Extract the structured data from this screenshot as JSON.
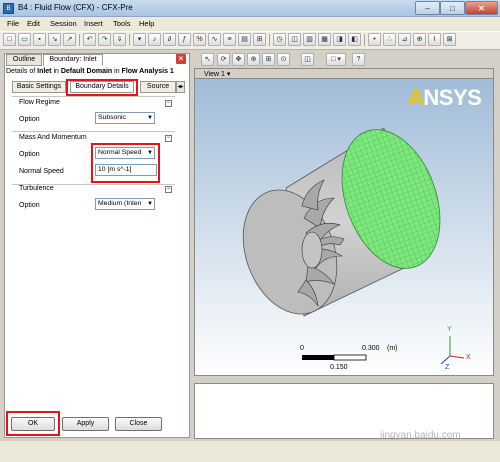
{
  "window": {
    "title": "B4 : Fluid Flow (CFX) - CFX-Pre",
    "app_icon": "cfx-app-icon"
  },
  "menu": [
    "File",
    "Edit",
    "Session",
    "Insert",
    "Tools",
    "Help"
  ],
  "toolbar": {
    "icons": [
      "new-icon",
      "open-icon",
      "save-icon",
      "import-icon",
      "export-icon",
      "undo-icon",
      "redo-icon",
      "insert-icon",
      "material-icon",
      "reaction-icon",
      "expression-icon",
      "function-icon",
      "variable-icon",
      "solver-control-icon",
      "output-control-icon",
      "monitor-icon",
      "mesh-adaption-icon",
      "initialization-icon",
      "interface-icon",
      "domain-icon",
      "boundary-icon",
      "subdomain-icon",
      "source-point-icon",
      "clock-icon",
      "particle-icon",
      "write-solver-icon",
      "calculator-icon",
      "chart-icon",
      "report-icon"
    ]
  },
  "left_panel": {
    "tabs": [
      "Outline",
      "Boundary: Inlet"
    ],
    "details": {
      "p1": "Details of ",
      "inlet": "Inlet",
      "p2": " in ",
      "domain": "Default Domain",
      "p3": " in ",
      "analysis": "Flow Analysis 1"
    },
    "subtabs": [
      "Basic Settings",
      "Boundary Details",
      "Source"
    ],
    "flow_regime": {
      "header": "Flow Regime",
      "option_label": "Option",
      "option_value": "Subsonic"
    },
    "mass_momentum": {
      "header": "Mass And Momentum",
      "option_label": "Option",
      "option_value": "Normal Speed",
      "speed_label": "Normal Speed",
      "speed_value": "10 [m s^-1]"
    },
    "turbulence": {
      "header": "Turbulence",
      "option_label": "Option",
      "option_value": "Medium (Inten"
    },
    "buttons": {
      "ok": "OK",
      "apply": "Apply",
      "close": "Close"
    }
  },
  "viewer": {
    "label": "View 1",
    "logo": "ANSYS",
    "scale": {
      "zero": "0",
      "max": "0.300",
      "unit": "(m)",
      "mid": "0.150"
    },
    "triad": {
      "x": "X",
      "y": "Y",
      "z": "Z"
    },
    "colors": {
      "inlet_face": "#7ee87e",
      "mesh_lines": "#2e9a2e",
      "cylinder": "#c8c8c8"
    }
  },
  "watermark": "jingyan.baidu.com"
}
